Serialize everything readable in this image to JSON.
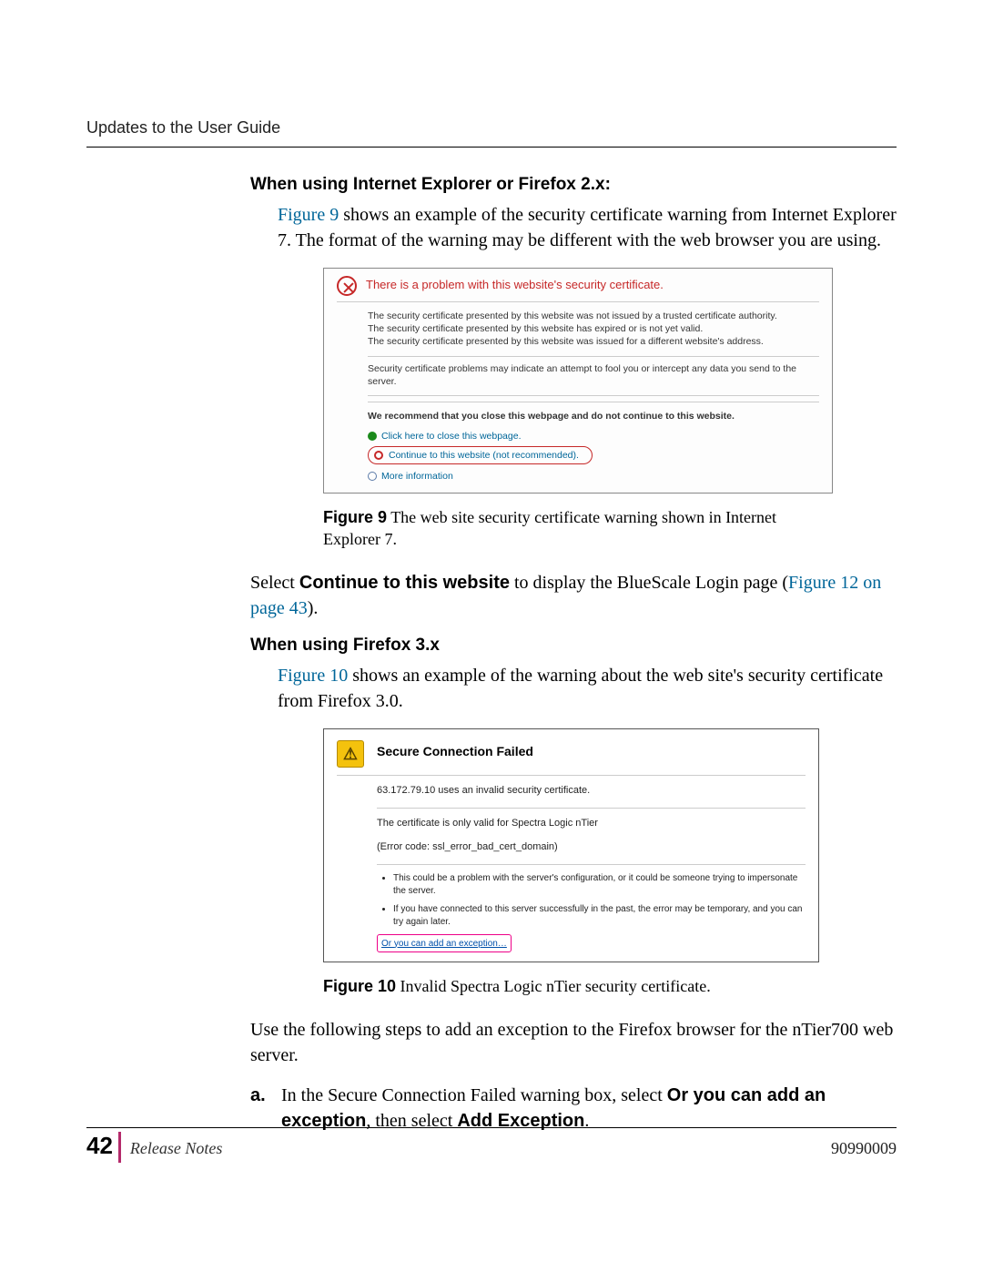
{
  "running_header": "Updates to the User Guide",
  "section1": {
    "heading": "When using Internet Explorer or Firefox 2.x:",
    "para1_a": "Figure 9",
    "para1_b": " shows an example of the security certificate warning from Internet Explorer 7. The format of the warning may be different with the web browser you are using."
  },
  "ie": {
    "title": "There is a problem with this website's security certificate.",
    "p1": "The security certificate presented by this website was not issued by a trusted certificate authority.",
    "p2": "The security certificate presented by this website has expired or is not yet valid.",
    "p3": "The security certificate presented by this website was issued for a different website's address.",
    "p4": "Security certificate problems may indicate an attempt to fool you or intercept any data you send to the server.",
    "recommend": "We recommend that you close this webpage and do not continue to this website.",
    "close_link": "Click here to close this webpage.",
    "continue_link": "Continue to this website (not recommended).",
    "more_info": "More information"
  },
  "fig9": {
    "label": "Figure 9",
    "text": "  The web site security certificate warning shown in Internet Explorer 7."
  },
  "select_para": {
    "a": "Select ",
    "b": "Continue to this website",
    "c": " to display the BlueScale Login page (",
    "d": "Figure 12 on page 43",
    "e": ")."
  },
  "section2": {
    "heading": "When using Firefox 3.x",
    "para_a": "Figure 10",
    "para_b": " shows an example of the warning about the web site's security certificate from Firefox 3.0."
  },
  "ff": {
    "title": "Secure Connection Failed",
    "p1": "63.172.79.10 uses an invalid security certificate.",
    "p2": "The certificate is only valid for Spectra Logic nTier",
    "p3": "(Error code: ssl_error_bad_cert_domain)",
    "li1": "This could be a problem with the server's configuration, or it could be someone trying to impersonate the server.",
    "li2": "If you have connected to this server successfully in the past, the error may be temporary, and you can try again later.",
    "exception": "Or you can add an exception…"
  },
  "fig10": {
    "label": "Figure 10",
    "text": "  Invalid Spectra Logic nTier security certificate."
  },
  "use_steps_para": "Use the following steps to add an exception to the Firefox browser for the nTier700 web server.",
  "step_a": {
    "marker": "a.",
    "t1": "In the Secure Connection Failed warning box, select ",
    "b1": "Or you can add an exception",
    "t2": ", then select ",
    "b2": "Add Exception",
    "t3": "."
  },
  "footer": {
    "page": "42",
    "title": "Release Notes",
    "code": "90990009"
  }
}
